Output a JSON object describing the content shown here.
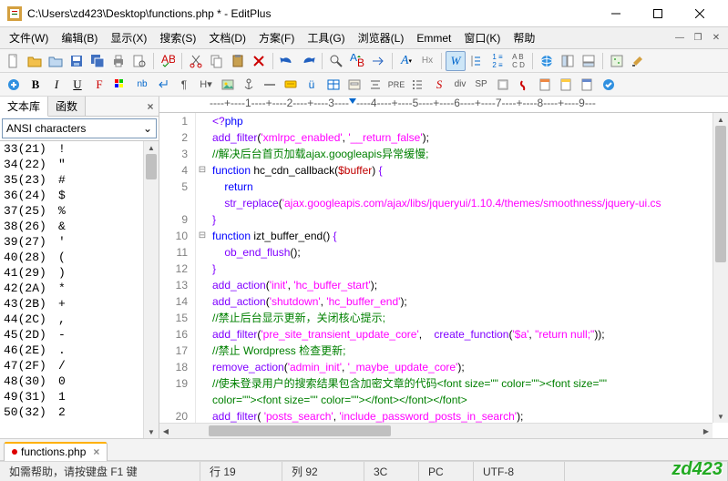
{
  "window": {
    "title": "C:\\Users\\zd423\\Desktop\\functions.php * - EditPlus"
  },
  "menus": {
    "file": "文件(W)",
    "edit": "编辑(B)",
    "view": "显示(X)",
    "search": "搜索(S)",
    "doc": "文档(D)",
    "scheme": "方案(F)",
    "tool": "工具(G)",
    "browser": "浏览器(L)",
    "emmet": "Emmet",
    "window": "窗口(K)",
    "help": "帮助"
  },
  "sidebar": {
    "tab_text": "文本库",
    "tab_fn": "函数",
    "select_label": "ANSI characters",
    "rows": [
      {
        "code": "33(21)",
        "ch": "!"
      },
      {
        "code": "34(22)",
        "ch": "\""
      },
      {
        "code": "35(23)",
        "ch": "#"
      },
      {
        "code": "36(24)",
        "ch": "$"
      },
      {
        "code": "37(25)",
        "ch": "%"
      },
      {
        "code": "38(26)",
        "ch": "&"
      },
      {
        "code": "39(27)",
        "ch": "'"
      },
      {
        "code": "40(28)",
        "ch": "("
      },
      {
        "code": "41(29)",
        "ch": ")"
      },
      {
        "code": "42(2A)",
        "ch": "*"
      },
      {
        "code": "43(2B)",
        "ch": "+"
      },
      {
        "code": "44(2C)",
        "ch": ","
      },
      {
        "code": "45(2D)",
        "ch": "-"
      },
      {
        "code": "46(2E)",
        "ch": "."
      },
      {
        "code": "47(2F)",
        "ch": "/"
      },
      {
        "code": "48(30)",
        "ch": "0"
      },
      {
        "code": "49(31)",
        "ch": "1"
      },
      {
        "code": "50(32)",
        "ch": "2"
      }
    ]
  },
  "ruler": "----+----1----+----2----+----3----+----4----+----5----+----6----+----7----+----8----+----9---",
  "code": {
    "lines": [
      {
        "n": 1,
        "t": [
          {
            "c": "br",
            "s": "<?"
          },
          {
            "c": "kw",
            "s": "php"
          }
        ]
      },
      {
        "n": 2,
        "t": [
          {
            "c": "fn",
            "s": "add_filter"
          },
          {
            "c": "",
            "s": "("
          },
          {
            "c": "str",
            "s": "'xmlrpc_enabled'"
          },
          {
            "c": "",
            "s": ", "
          },
          {
            "c": "str",
            "s": "'__return_false'"
          },
          {
            "c": "",
            "s": ");"
          }
        ]
      },
      {
        "n": 3,
        "t": [
          {
            "c": "cmt",
            "s": "//解决后台首页加载ajax.googleapis异常缓慢;"
          }
        ]
      },
      {
        "n": 4,
        "fold": "⊟",
        "t": [
          {
            "c": "kw",
            "s": "function"
          },
          {
            "c": "",
            "s": " hc_cdn_callback("
          },
          {
            "c": "var",
            "s": "$buffer"
          },
          {
            "c": "",
            "s": ") "
          },
          {
            "c": "br",
            "s": "{"
          }
        ]
      },
      {
        "n": 5,
        "t": [
          {
            "c": "",
            "s": "    "
          },
          {
            "c": "kw",
            "s": "return"
          }
        ]
      },
      {
        "n": "",
        "t": [
          {
            "c": "",
            "s": "    "
          },
          {
            "c": "fn",
            "s": "str_replace"
          },
          {
            "c": "",
            "s": "("
          },
          {
            "c": "str",
            "s": "'ajax.googleapis.com/ajax/libs/jqueryui/1.10.4/themes/smoothness/jquery-ui.cs"
          }
        ]
      },
      {
        "n": 9,
        "t": [
          {
            "c": "br",
            "s": "}"
          }
        ]
      },
      {
        "n": 10,
        "fold": "⊟",
        "t": [
          {
            "c": "kw",
            "s": "function"
          },
          {
            "c": "",
            "s": " izt_buffer_end() "
          },
          {
            "c": "br",
            "s": "{"
          }
        ]
      },
      {
        "n": 11,
        "t": [
          {
            "c": "",
            "s": "    "
          },
          {
            "c": "fn",
            "s": "ob_end_flush"
          },
          {
            "c": "",
            "s": "();"
          }
        ]
      },
      {
        "n": 12,
        "t": [
          {
            "c": "br",
            "s": "}"
          }
        ]
      },
      {
        "n": 13,
        "t": [
          {
            "c": "fn",
            "s": "add_action"
          },
          {
            "c": "",
            "s": "("
          },
          {
            "c": "str",
            "s": "'init'"
          },
          {
            "c": "",
            "s": ", "
          },
          {
            "c": "str",
            "s": "'hc_buffer_start'"
          },
          {
            "c": "",
            "s": ");"
          }
        ]
      },
      {
        "n": 14,
        "t": [
          {
            "c": "fn",
            "s": "add_action"
          },
          {
            "c": "",
            "s": "("
          },
          {
            "c": "str",
            "s": "'shutdown'"
          },
          {
            "c": "",
            "s": ", "
          },
          {
            "c": "str",
            "s": "'hc_buffer_end'"
          },
          {
            "c": "",
            "s": ");"
          }
        ]
      },
      {
        "n": 15,
        "t": [
          {
            "c": "cmt",
            "s": "//禁止后台显示更新，关闭核心提示;"
          }
        ]
      },
      {
        "n": 16,
        "t": [
          {
            "c": "fn",
            "s": "add_filter"
          },
          {
            "c": "",
            "s": "("
          },
          {
            "c": "str",
            "s": "'pre_site_transient_update_core'"
          },
          {
            "c": "",
            "s": ",    "
          },
          {
            "c": "fn",
            "s": "create_function"
          },
          {
            "c": "",
            "s": "("
          },
          {
            "c": "str",
            "s": "'$a'"
          },
          {
            "c": "",
            "s": ", "
          },
          {
            "c": "str",
            "s": "\"return null;\""
          },
          {
            "c": "",
            "s": "));"
          }
        ]
      },
      {
        "n": 17,
        "t": [
          {
            "c": "cmt",
            "s": "//禁止 Wordpress 检查更新;"
          }
        ]
      },
      {
        "n": 18,
        "t": [
          {
            "c": "fn",
            "s": "remove_action"
          },
          {
            "c": "",
            "s": "("
          },
          {
            "c": "str",
            "s": "'admin_init'"
          },
          {
            "c": "",
            "s": ", "
          },
          {
            "c": "str",
            "s": "'_maybe_update_core'"
          },
          {
            "c": "",
            "s": ");"
          }
        ]
      },
      {
        "n": 19,
        "t": [
          {
            "c": "cmt",
            "s": "//使未登录用户的搜索结果包含加密文章的代码<font size=\"\" color=\"\"><font size=\"\""
          }
        ]
      },
      {
        "n": "",
        "t": [
          {
            "c": "cmt",
            "s": "color=\"\"><font size=\"\" color=\"\"></font></font></font>"
          }
        ]
      },
      {
        "n": 20,
        "t": [
          {
            "c": "fn",
            "s": "add_filter"
          },
          {
            "c": "",
            "s": "( "
          },
          {
            "c": "str",
            "s": "'posts_search'"
          },
          {
            "c": "",
            "s": ", "
          },
          {
            "c": "str",
            "s": "'include_password_posts_in_search'"
          },
          {
            "c": "",
            "s": ");"
          }
        ]
      }
    ]
  },
  "doctab": {
    "name": "functions.php"
  },
  "status": {
    "hint": "如需帮助，请按键盘 F1 键",
    "line": "行 19",
    "col": "列 92",
    "lines": "3C",
    "enc": "PC",
    "charset": "UTF-8"
  },
  "logo": "zd423"
}
